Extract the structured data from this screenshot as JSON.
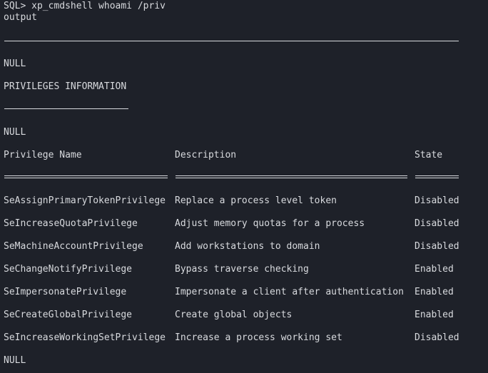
{
  "prompt": "SQL> xp_cmdshell whoami /priv",
  "header": "output",
  "null_label": "NULL",
  "section_title": "PRIVILEGES INFORMATION",
  "columns": [
    "Privilege Name",
    "Description",
    "State"
  ],
  "rows": [
    {
      "name": "SeAssignPrimaryTokenPrivilege",
      "description": "Replace a process level token",
      "state": "Disabled"
    },
    {
      "name": "SeIncreaseQuotaPrivilege",
      "description": "Adjust memory quotas for a process",
      "state": "Disabled"
    },
    {
      "name": "SeMachineAccountPrivilege",
      "description": "Add workstations to domain",
      "state": "Disabled"
    },
    {
      "name": "SeChangeNotifyPrivilege",
      "description": "Bypass traverse checking",
      "state": "Enabled"
    },
    {
      "name": "SeImpersonatePrivilege",
      "description": "Impersonate a client after authentication",
      "state": "Enabled"
    },
    {
      "name": "SeCreateGlobalPrivilege",
      "description": "Create global objects",
      "state": "Enabled"
    },
    {
      "name": "SeIncreaseWorkingSetPrivilege",
      "description": "Increase a process working set",
      "state": "Disabled"
    }
  ],
  "colors": {
    "background": "#1e2129",
    "text": "#d8dade"
  }
}
